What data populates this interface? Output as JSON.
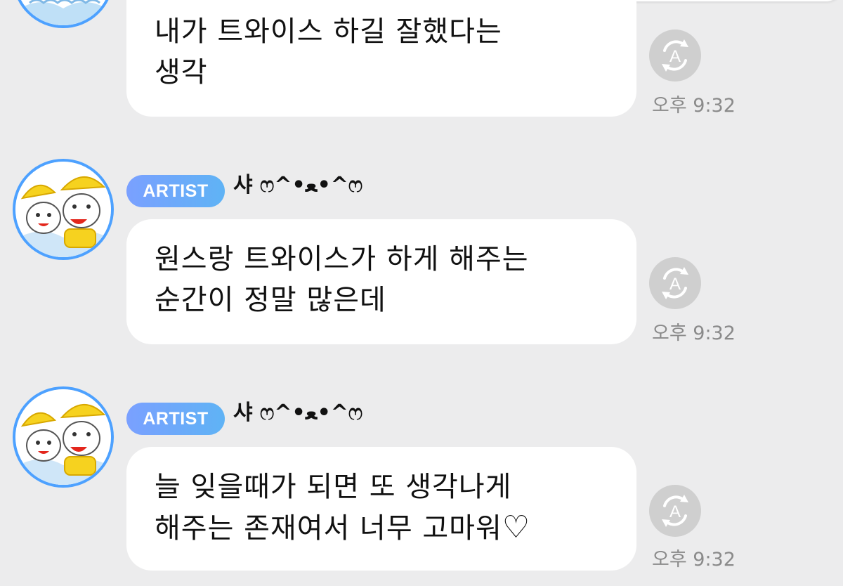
{
  "messages": [
    {
      "show_header": false,
      "artist_badge": "",
      "author": "",
      "lines": [
        "내가 트와이스 하길 잘했다는",
        "생각"
      ],
      "time": "오후 9:32"
    },
    {
      "show_header": true,
      "artist_badge": "ARTIST",
      "author": "샤 ෆ^•ﻌ•^ෆ",
      "lines": [
        "원스랑 트와이스가 하게 해주는",
        "순간이 정말 많은데"
      ],
      "time": "오후 9:32"
    },
    {
      "show_header": true,
      "artist_badge": "ARTIST",
      "author": "샤 ෆ^•ﻌ•^ෆ",
      "lines": [
        "늘 잊을때가 되면 또 생각나게",
        "해주는 존재여서 너무 고마워"
      ],
      "heart": "♡",
      "time": "오후 9:32"
    }
  ],
  "icons": {
    "translate": "translate-icon",
    "avatar": "avatar-cat-illustration"
  },
  "colors": {
    "background": "#ececed",
    "bubble": "#ffffff",
    "badge_start": "#7aa0ff",
    "badge_end": "#5fb3f5",
    "avatar_ring": "#4da1ff",
    "timestamp": "#8a8a8a",
    "translate_button": "#cfcfcf"
  }
}
